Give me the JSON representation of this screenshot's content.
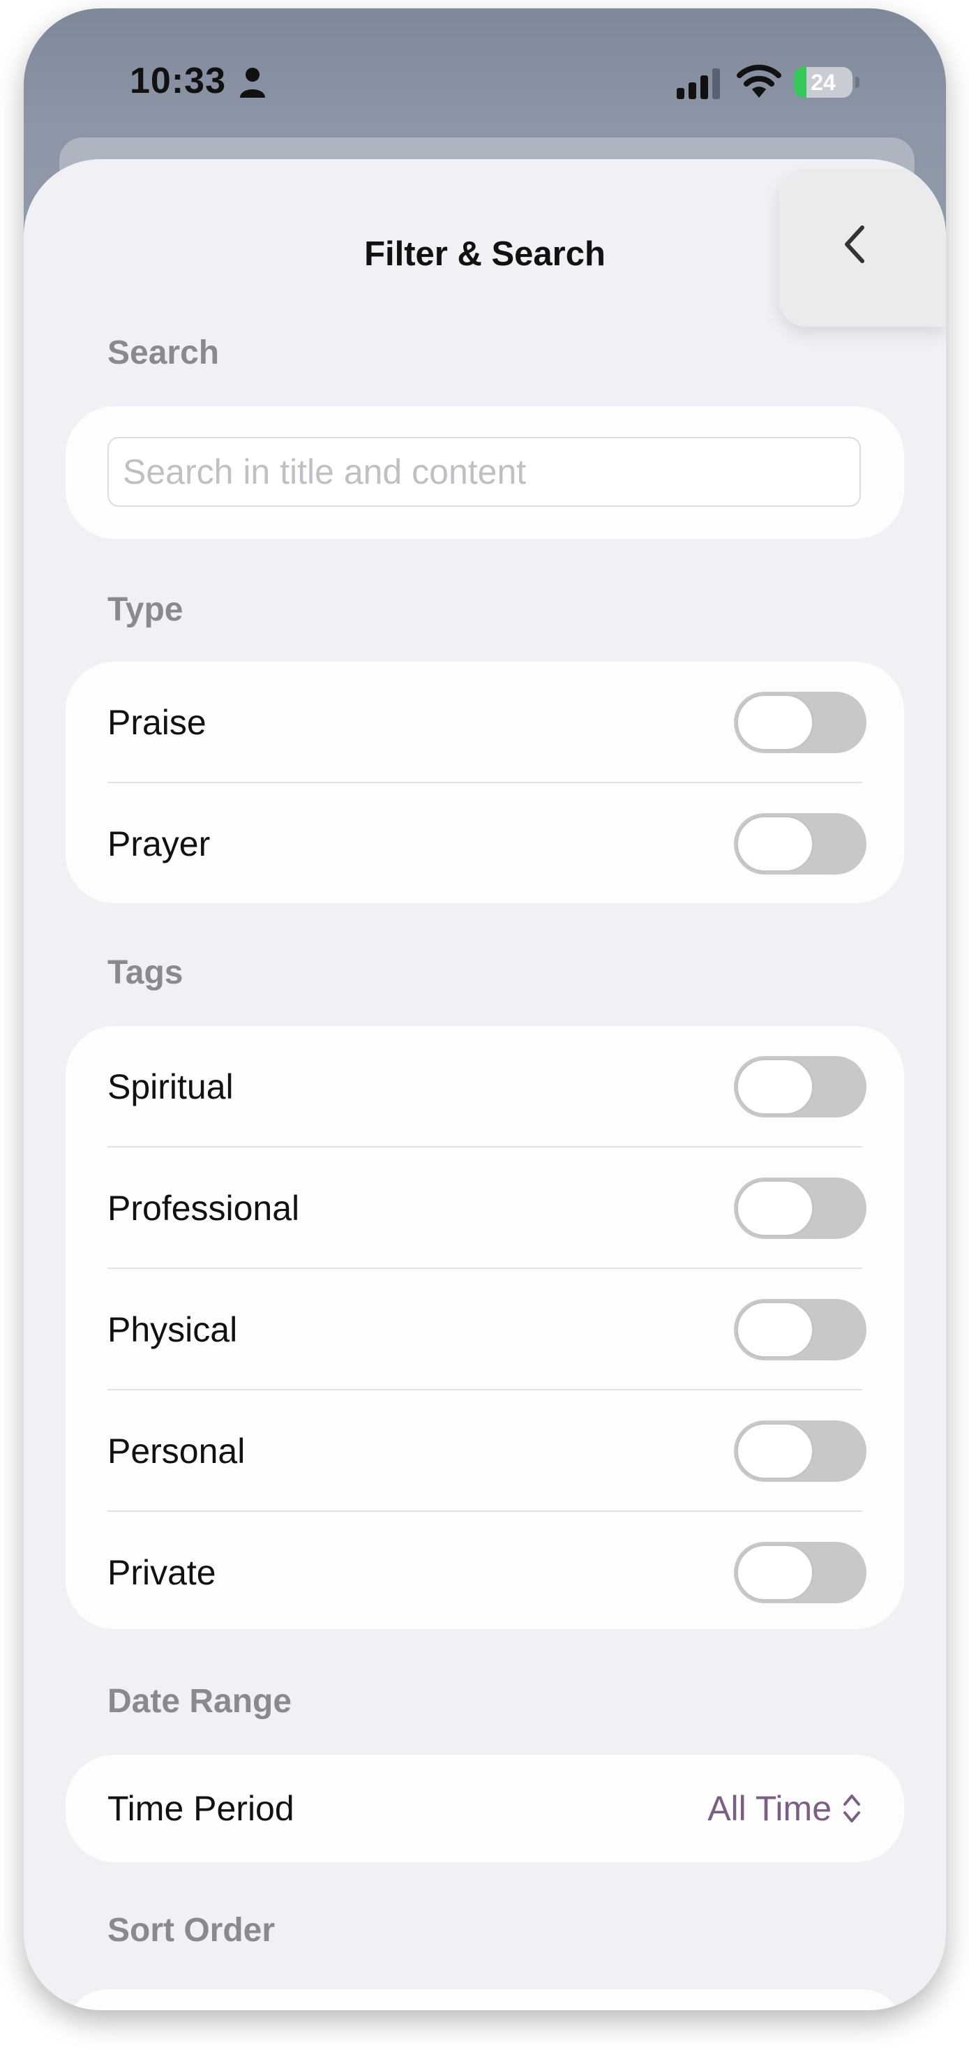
{
  "status_bar": {
    "time": "10:33",
    "battery": "24"
  },
  "sheet": {
    "title": "Filter & Search"
  },
  "search": {
    "header": "Search",
    "placeholder": "Search in title and content",
    "value": ""
  },
  "type": {
    "header": "Type",
    "items": [
      {
        "label": "Praise",
        "on": false
      },
      {
        "label": "Prayer",
        "on": false
      }
    ]
  },
  "tags": {
    "header": "Tags",
    "items": [
      {
        "label": "Spiritual",
        "on": false
      },
      {
        "label": "Professional",
        "on": false
      },
      {
        "label": "Physical",
        "on": false
      },
      {
        "label": "Personal",
        "on": false
      },
      {
        "label": "Private",
        "on": false
      }
    ]
  },
  "date_range": {
    "header": "Date Range",
    "label": "Time Period",
    "value": "All Time"
  },
  "sort": {
    "header": "Sort Order"
  },
  "colors": {
    "accent": "#7b5f82",
    "battery_green": "#35c759"
  }
}
